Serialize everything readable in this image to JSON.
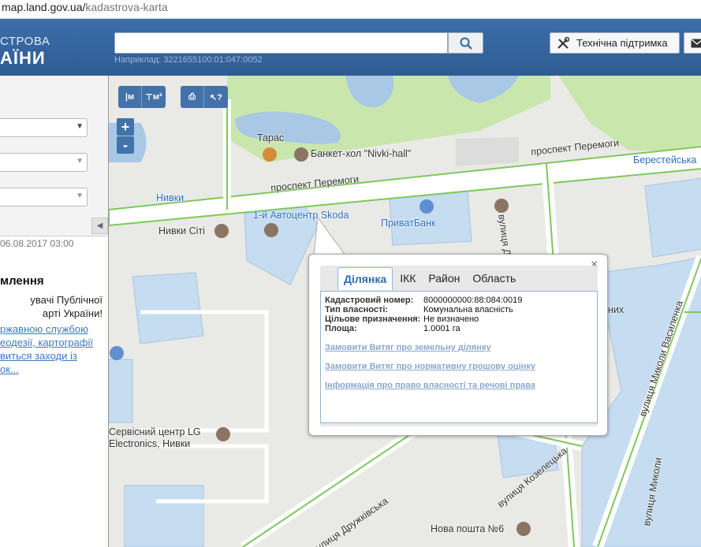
{
  "browser": {
    "url_host": "map.land.gov.ua/",
    "url_path": "kadastrova-karta"
  },
  "header": {
    "logo_line1": "СТРОВА",
    "logo_line2": "АЇНИ",
    "search_value": "",
    "example": "Наприклад: 3221655100:01:047:0052",
    "support_label": "Технічна підтримка"
  },
  "sidebar": {
    "date": "06.08.2017 03:00",
    "title": "млення",
    "text": "увачі Публічної\nарті України!",
    "link": "ржавною службою\nеодезії, картографії\nвиться заходи із\nок..."
  },
  "map": {
    "tools": {
      "measure_label": "м",
      "area_label": "м²"
    },
    "zoom_in": "+",
    "zoom_out": "-",
    "labels": {
      "taras": "Тарас",
      "banket": "Банкет-хол \"Nivki-hall\"",
      "peremohy_top": "проспект Перемоги",
      "beresteiska": "Берестейська",
      "peremohy_main": "проспект Перемоги",
      "nyvky_metro": "Нивки",
      "skoda": "1-й Автоцентр Skoda",
      "privatbank": "ПриватБанк",
      "nyvky_city": "Нивки Сіті",
      "druzhkivska": "вулиця Дружківська",
      "lg": "Сервісний центр LG\nElectronics, Нивки",
      "nova_poshta": "Нова пошта №6",
      "kozelets": "вулиця Козелецька",
      "vasylenka": "вулиця Миколи Василенка",
      "mykoly": "вулиця Миколи",
      "druzhkivska_bottom": "вулиця Дружківська",
      "nykh": "них"
    }
  },
  "popup": {
    "tabs": [
      "Ділянка",
      "ІКК",
      "Район",
      "Область"
    ],
    "active_tab": "Ділянка",
    "fields": [
      {
        "label": "Кадастровий номер:",
        "value": "8000000000:88:084:0019"
      },
      {
        "label": "Тип власності:",
        "value": "Комунальна власність"
      },
      {
        "label": "Цільове призначення:",
        "value": "Не визначено"
      },
      {
        "label": "Площа:",
        "value": "1.0001 га"
      }
    ],
    "links": [
      "Замовити Витяг про земельну ділянку",
      "Замовити Витяг про нормативну грошову оцінку",
      "Інформація про право власності та речові права"
    ],
    "close": "×"
  },
  "colors": {
    "header_blue": "#2f5c93",
    "road_green": "#7ec85a",
    "parcel_blue": "#c6dcf0",
    "water": "#a9c8e6",
    "park": "#c9e7ad",
    "link": "#3a7abf"
  }
}
